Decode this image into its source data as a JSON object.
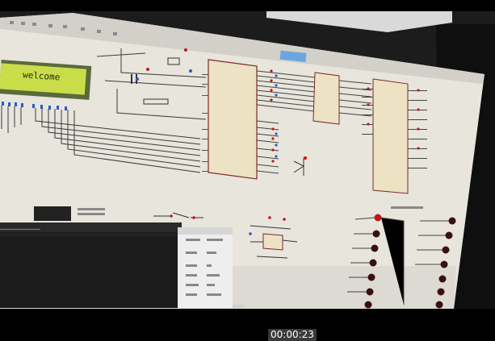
{
  "scene": {
    "lcd_text": "welcome",
    "background_color": "#000000",
    "screen_color": "#e9e6d8",
    "chip_color": "#ede2c3",
    "led_color": "#c01818"
  },
  "overlay": {
    "timestamp": "00:00:23"
  }
}
